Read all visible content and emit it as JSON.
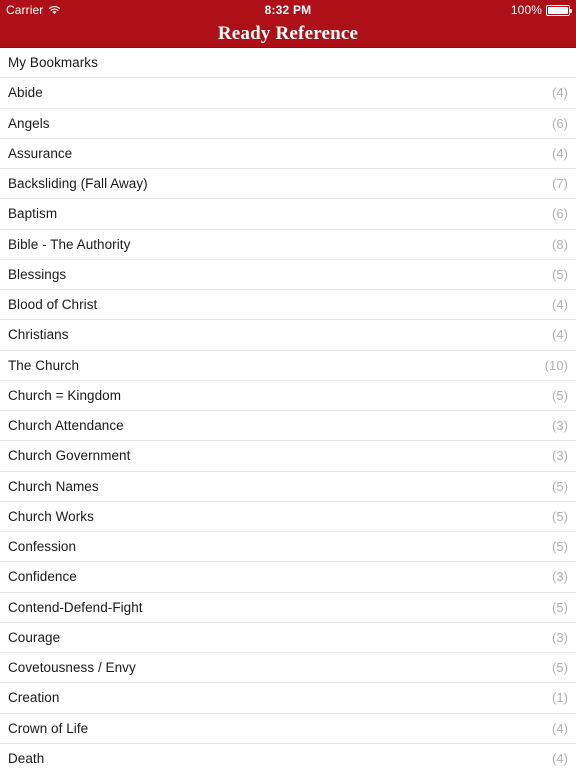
{
  "status_bar": {
    "carrier": "Carrier",
    "wifi_icon": "wifi-icon",
    "time": "8:32 PM",
    "battery_percent": "100%",
    "battery_icon": "battery-full-icon"
  },
  "nav_bar": {
    "title": "Ready Reference"
  },
  "colors": {
    "nav_background": "#AE1017",
    "nav_text": "#FFFFFF",
    "row_text": "#1A1A1A",
    "count_text": "#B0B0B0",
    "separator": "#E8E8E8",
    "page_background": "#FFFFFF"
  },
  "list": {
    "rows": [
      {
        "label": "My Bookmarks",
        "count": ""
      },
      {
        "label": "Abide",
        "count": "(4)"
      },
      {
        "label": "Angels",
        "count": "(6)"
      },
      {
        "label": "Assurance",
        "count": "(4)"
      },
      {
        "label": "Backsliding (Fall Away)",
        "count": "(7)"
      },
      {
        "label": "Baptism",
        "count": "(6)"
      },
      {
        "label": "Bible - The Authority",
        "count": "(8)"
      },
      {
        "label": "Blessings",
        "count": "(5)"
      },
      {
        "label": "Blood of Christ",
        "count": "(4)"
      },
      {
        "label": "Christians",
        "count": "(4)"
      },
      {
        "label": "The Church",
        "count": "(10)"
      },
      {
        "label": "Church = Kingdom",
        "count": "(5)"
      },
      {
        "label": "Church Attendance",
        "count": "(3)"
      },
      {
        "label": "Church Government",
        "count": "(3)"
      },
      {
        "label": "Church Names",
        "count": "(5)"
      },
      {
        "label": "Church Works",
        "count": "(5)"
      },
      {
        "label": "Confession",
        "count": "(5)"
      },
      {
        "label": "Confidence",
        "count": "(3)"
      },
      {
        "label": "Contend-Defend-Fight",
        "count": "(5)"
      },
      {
        "label": "Courage",
        "count": "(3)"
      },
      {
        "label": "Covetousness / Envy",
        "count": "(5)"
      },
      {
        "label": "Creation",
        "count": "(1)"
      },
      {
        "label": "Crown of Life",
        "count": "(4)"
      },
      {
        "label": "Death",
        "count": "(4)"
      }
    ]
  }
}
